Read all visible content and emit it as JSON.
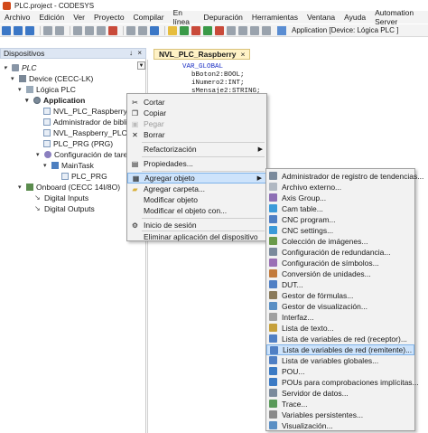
{
  "window": {
    "title": "PLC.project - CODESYS"
  },
  "menubar": [
    "Archivo",
    "Edición",
    "Ver",
    "Proyecto",
    "Compilar",
    "En línea",
    "Depuración",
    "Herramientas",
    "Ventana",
    "Ayuda",
    "Automation Server"
  ],
  "toolbar": {
    "device_label": "Application [Device: Lógica PLC ]"
  },
  "devices_panel": {
    "title": "Dispositivos",
    "pin_glyph": "↓",
    "close_glyph": "×",
    "tree": [
      {
        "label": "PLC",
        "italic": true
      },
      {
        "label": "Device (CECC-LK)"
      },
      {
        "label": "Lógica PLC"
      },
      {
        "label": "Application",
        "bold": true
      },
      {
        "label": "NVL_PLC_Raspberry"
      },
      {
        "label": "Administrador de biblioteca"
      },
      {
        "label": "NVL_Raspberry_PLC"
      },
      {
        "label": "PLC_PRG (PRG)"
      },
      {
        "label": "Configuración de tareas"
      },
      {
        "label": "MainTask"
      },
      {
        "label": "PLC_PRG"
      },
      {
        "label": "Onboard (CECC 14I/8O)"
      },
      {
        "label": "Digital Inputs"
      },
      {
        "label": "Digital Outputs"
      }
    ]
  },
  "editor": {
    "tab_label": "NVL_PLC_Raspberry",
    "tab_close": "×",
    "lines": [
      "VAR_GLOBAL",
      "bBoton2:BOOL;",
      "iNumero2:INT;",
      "sMensaje2:STRING;"
    ]
  },
  "context_menu": {
    "items": [
      {
        "label": "Cortar",
        "icon": "scissors-icon",
        "glyph": "✂"
      },
      {
        "label": "Copiar",
        "icon": "copy-icon",
        "glyph": "❐"
      },
      {
        "label": "Pegar",
        "icon": "paste-icon",
        "glyph": "📋",
        "disabled": true
      },
      {
        "label": "Borrar",
        "icon": "delete-icon",
        "glyph": "✕"
      },
      {
        "label": "Refactorización",
        "submenu": true
      },
      {
        "label": "Propiedades...",
        "icon": "properties-icon",
        "glyph": "▤"
      },
      {
        "label": "Agregar objeto",
        "submenu": true,
        "highlighted": true,
        "icon": "add-object-icon",
        "glyph": "▦"
      },
      {
        "label": "Agregar carpeta...",
        "icon": "folder-icon",
        "glyph": "▰"
      },
      {
        "label": "Modificar objeto"
      },
      {
        "label": "Modificar el objeto con..."
      },
      {
        "label": "Inicio de sesión",
        "icon": "login-icon",
        "glyph": "⚙"
      },
      {
        "label": "Eliminar aplicación del dispositivo"
      }
    ],
    "submenu_arrow": "▶"
  },
  "submenu": {
    "items": [
      {
        "label": "Administrador de registro de tendencias...",
        "color": "#7a8a9c"
      },
      {
        "label": "Archivo externo...",
        "color": "#b0b8c2"
      },
      {
        "label": "Axis Group...",
        "color": "#8d6fb5"
      },
      {
        "label": "Cam table...",
        "color": "#3b9ad9"
      },
      {
        "label": "CNC program...",
        "color": "#4f7fc4"
      },
      {
        "label": "CNC settings...",
        "color": "#3b9ad9"
      },
      {
        "label": "Colección de imágenes...",
        "color": "#6a9a4a"
      },
      {
        "label": "Configuración de redundancia...",
        "color": "#7a8a9c"
      },
      {
        "label": "Configuración de símbolos...",
        "color": "#9a6fb5"
      },
      {
        "label": "Conversión de unidades...",
        "color": "#c27a3b"
      },
      {
        "label": "DUT...",
        "color": "#4f7fc4"
      },
      {
        "label": "Gestor de fórmulas...",
        "color": "#8a7a5a"
      },
      {
        "label": "Gestor de visualización...",
        "color": "#5a8fc4"
      },
      {
        "label": "Interfaz...",
        "color": "#a0a0a0"
      },
      {
        "label": "Lista de texto...",
        "color": "#c6a03b"
      },
      {
        "label": "Lista de variables de red (receptor)...",
        "color": "#4f7fc4"
      },
      {
        "label": "Lista de variables de red (remitente)...",
        "color": "#4f7fc4",
        "highlighted": true
      },
      {
        "label": "Lista de variables globales...",
        "color": "#4f7fc4"
      },
      {
        "label": "POU...",
        "color": "#3b7ac4"
      },
      {
        "label": "POUs para comprobaciones implícitas...",
        "color": "#3b7ac4"
      },
      {
        "label": "Servidor de datos...",
        "color": "#7a8a9c"
      },
      {
        "label": "Trace...",
        "color": "#5a9a5a"
      },
      {
        "label": "Variables persistentes...",
        "color": "#8a8a8a"
      },
      {
        "label": "Visualización...",
        "color": "#5a8fc4"
      }
    ]
  }
}
